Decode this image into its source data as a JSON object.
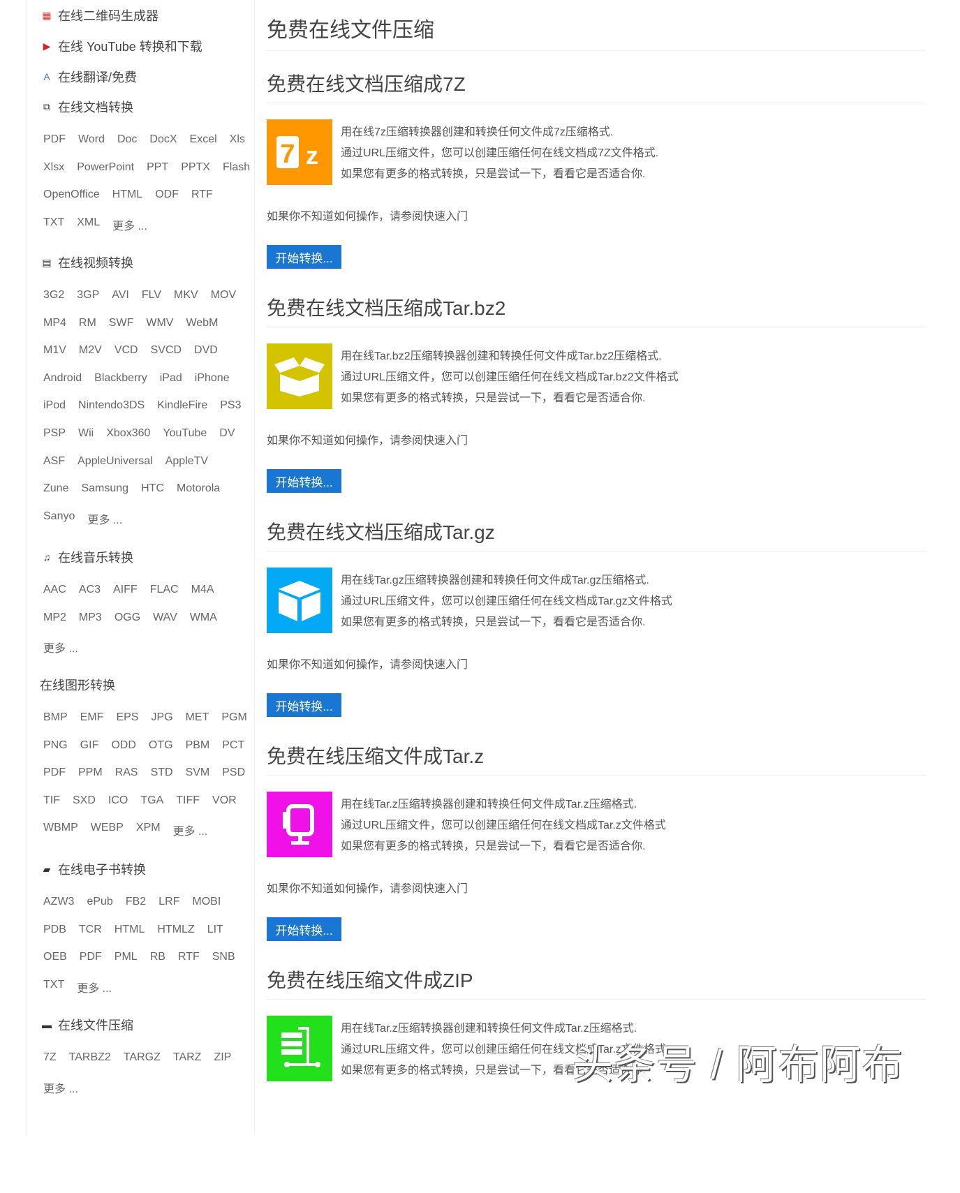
{
  "sidebar": {
    "links": [
      {
        "label": "在线二维码生成器",
        "icon": "qr-code-icon"
      },
      {
        "label": "在线 YouTube 转换和下载",
        "icon": "youtube-icon"
      },
      {
        "label": "在线翻译/免费",
        "icon": "translate-icon"
      }
    ],
    "categories": [
      {
        "label": "在线文档转换",
        "icon": "document-icon",
        "rows": [
          [
            "PDF",
            "Word",
            "Doc",
            "DocX",
            "Excel",
            "Xls"
          ],
          [
            "Xlsx",
            "PowerPoint",
            "PPT",
            "PPTX",
            "Flash"
          ],
          [
            "OpenOffice",
            "HTML",
            "ODF",
            "RTF"
          ],
          [
            "TXT",
            "XML",
            "更多 ..."
          ]
        ]
      },
      {
        "label": "在线视频转换",
        "icon": "film-icon",
        "rows": [
          [
            "3G2",
            "3GP",
            "AVI",
            "FLV",
            "MKV",
            "MOV"
          ],
          [
            "MP4",
            "RM",
            "SWF",
            "WMV",
            "WebM"
          ],
          [
            "M1V",
            "M2V",
            "VCD",
            "SVCD",
            "DVD"
          ],
          [
            "Android",
            "Blackberry",
            "iPad",
            "iPhone"
          ],
          [
            "iPod",
            "Nintendo3DS",
            "KindleFire",
            "PS3"
          ],
          [
            "PSP",
            "Wii",
            "Xbox360",
            "YouTube",
            "DV"
          ],
          [
            "ASF",
            "AppleUniversal",
            "AppleTV"
          ],
          [
            "Zune",
            "Samsung",
            "HTC",
            "Motorola"
          ],
          [
            "Sanyo",
            "更多 ..."
          ]
        ]
      },
      {
        "label": "在线音乐转换",
        "icon": "music-icon",
        "rows": [
          [
            "AAC",
            "AC3",
            "AIFF",
            "FLAC",
            "M4A"
          ],
          [
            "MP2",
            "MP3",
            "OGG",
            "WAV",
            "WMA"
          ],
          [
            "更多 ..."
          ]
        ]
      },
      {
        "label": "在线图形转换",
        "icon": "",
        "rows": [
          [
            "BMP",
            "EMF",
            "EPS",
            "JPG",
            "MET",
            "PGM"
          ],
          [
            "PNG",
            "GIF",
            "ODD",
            "OTG",
            "PBM",
            "PCT"
          ],
          [
            "PDF",
            "PPM",
            "RAS",
            "STD",
            "SVM",
            "PSD"
          ],
          [
            "TIF",
            "SXD",
            "ICO",
            "TGA",
            "TIFF",
            "VOR"
          ],
          [
            "WBMP",
            "WEBP",
            "XPM",
            "更多 ..."
          ]
        ]
      },
      {
        "label": "在线电子书转换",
        "icon": "book-icon",
        "rows": [
          [
            "AZW3",
            "ePub",
            "FB2",
            "LRF",
            "MOBI"
          ],
          [
            "PDB",
            "TCR",
            "HTML",
            "HTMLZ",
            "LIT"
          ],
          [
            "OEB",
            "PDF",
            "PML",
            "RB",
            "RTF",
            "SNB"
          ],
          [
            "TXT",
            "更多 ..."
          ]
        ]
      },
      {
        "label": "在线文件压缩",
        "icon": "briefcase-icon",
        "rows": [
          [
            "7Z",
            "TARBZ2",
            "TARGZ",
            "TARZ",
            "ZIP"
          ],
          [
            "更多 ..."
          ]
        ]
      }
    ]
  },
  "main": {
    "title": "免费在线文件压缩",
    "sections": [
      {
        "title": "免费在线文档压缩成7Z",
        "icon": "7z-icon",
        "color": "#ff9800",
        "lines": [
          "用在线7z压缩转换器创建和转换任何文件成7z压缩格式.",
          "通过URL压缩文件，您可以创建压缩任何在线文档成7Z文件格式.",
          "如果您有更多的格式转换，只是尝试一下，看看它是否适合你."
        ],
        "help": "如果你不知道如何操作，请参阅快速入门",
        "button": "开始转换..."
      },
      {
        "title": "免费在线文档压缩成Tar.bz2",
        "icon": "open-box-icon",
        "color": "#d4c400",
        "lines": [
          "用在线Tar.bz2压缩转换器创建和转换任何文件成Tar.bz2压缩格式.",
          "通过URL压缩文件，您可以创建压缩任何在线文档成Tar.bz2文件格式",
          "如果您有更多的格式转换，只是尝试一下，看看它是否适合你."
        ],
        "help": "如果你不知道如何操作，请参阅快速入门",
        "button": "开始转换..."
      },
      {
        "title": "免费在线文档压缩成Tar.gz",
        "icon": "box-icon",
        "color": "#03a9f4",
        "lines": [
          "用在线Tar.gz压缩转换器创建和转换任何文件成Tar.gz压缩格式.",
          "通过URL压缩文件，您可以创建压缩任何在线文档成Tar.gz文件格式",
          "如果您有更多的格式转换，只是尝试一下，看看它是否适合你."
        ],
        "help": "如果你不知道如何操作，请参阅快速入门",
        "button": "开始转换..."
      },
      {
        "title": "免费在线压缩文件成Tar.z",
        "icon": "compress-icon",
        "color": "#f011e8",
        "lines": [
          "用在线Tar.z压缩转换器创建和转换任何文件成Tar.z压缩格式.",
          "通过URL压缩文件，您可以创建压缩任何在线文档成Tar.z文件格式",
          "如果您有更多的格式转换，只是尝试一下，看看它是否适合你."
        ],
        "help": "如果你不知道如何操作，请参阅快速入门",
        "button": "开始转换..."
      },
      {
        "title": "免费在线压缩文件成ZIP",
        "icon": "zip-clamp-icon",
        "color": "#22e01a",
        "lines": [
          "用在线Tar.z压缩转换器创建和转换任何文件成Tar.z压缩格式.",
          "通过URL压缩文件，您可以创建压缩任何在线文档成Tar.z文件格式",
          "如果您有更多的格式转换，只是尝试一下，看看它是否适合你."
        ],
        "help": "",
        "button": ""
      }
    ]
  },
  "watermark": "头条号 / 阿布阿布"
}
